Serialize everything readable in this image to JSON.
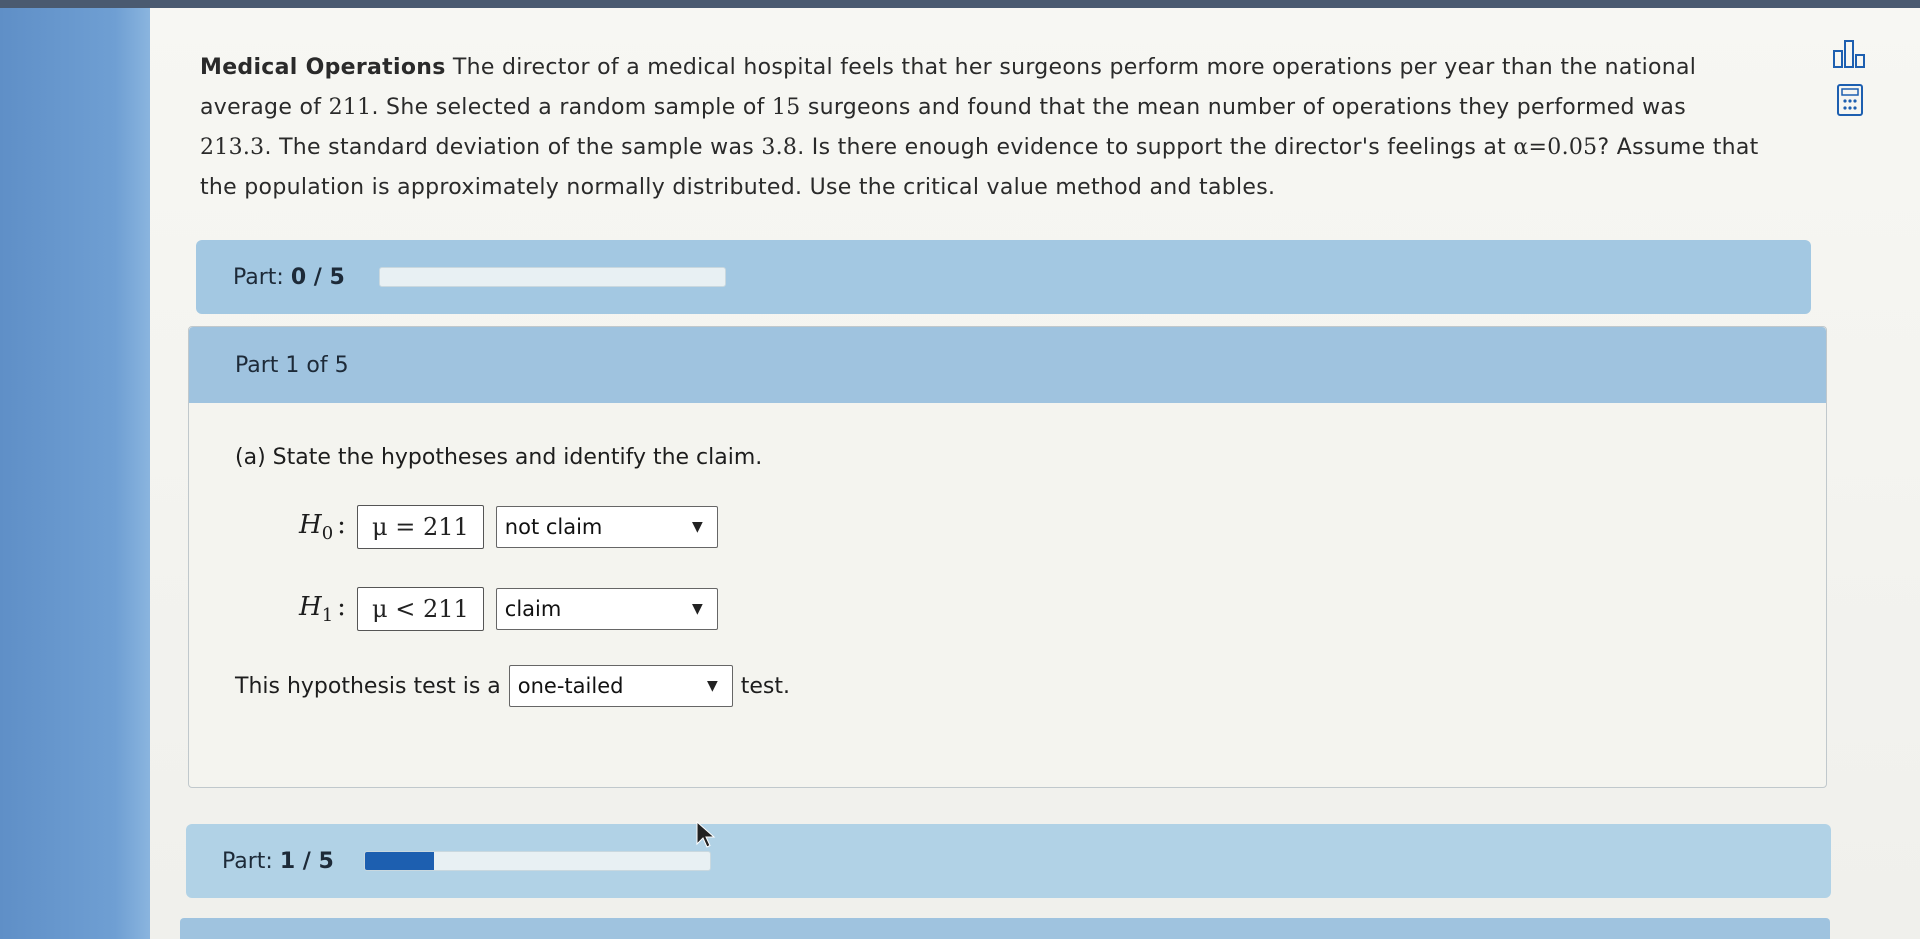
{
  "problem": {
    "title": "Medical Operations",
    "text_a": "The director of a medical hospital feels that her surgeons perform more operations per year than the national average of ",
    "national_average": "211",
    "text_b": ". She selected a random sample of ",
    "sample_size": "15",
    "text_c": " surgeons and found that the mean number of operations they performed was ",
    "sample_mean": "213.3",
    "text_d": ". The standard deviation of the sample was ",
    "sample_sd": "3.8",
    "text_e": ". Is there enough evidence to support the director's feelings at ",
    "alpha_expr": "α=0.05",
    "text_f": "? Assume that the population is approximately normally distributed. Use the critical value method and tables."
  },
  "progress_top": {
    "prefix": "Part: ",
    "value": "0 / 5",
    "fraction": 0
  },
  "part1": {
    "header": "Part 1 of 5",
    "question": "(a) State the hypotheses and identify the claim.",
    "h0": {
      "label": "H",
      "sub": "0",
      "colon": ":",
      "expr": "μ = 211",
      "select": "not claim"
    },
    "h1": {
      "label": "H",
      "sub": "1",
      "colon": ":",
      "expr": "μ < 211",
      "select": "claim"
    },
    "test_prefix": "This hypothesis test is a",
    "test_select": "one-tailed",
    "test_suffix": "test."
  },
  "progress_bottom": {
    "prefix": "Part: ",
    "value": "1 / 5",
    "fraction": 0.2
  },
  "caret": "▼",
  "colors": {
    "accent": "#1d5fb0",
    "part_bar": "#a3c8e2"
  },
  "icons": [
    "chart-icon",
    "calculator-icon"
  ]
}
